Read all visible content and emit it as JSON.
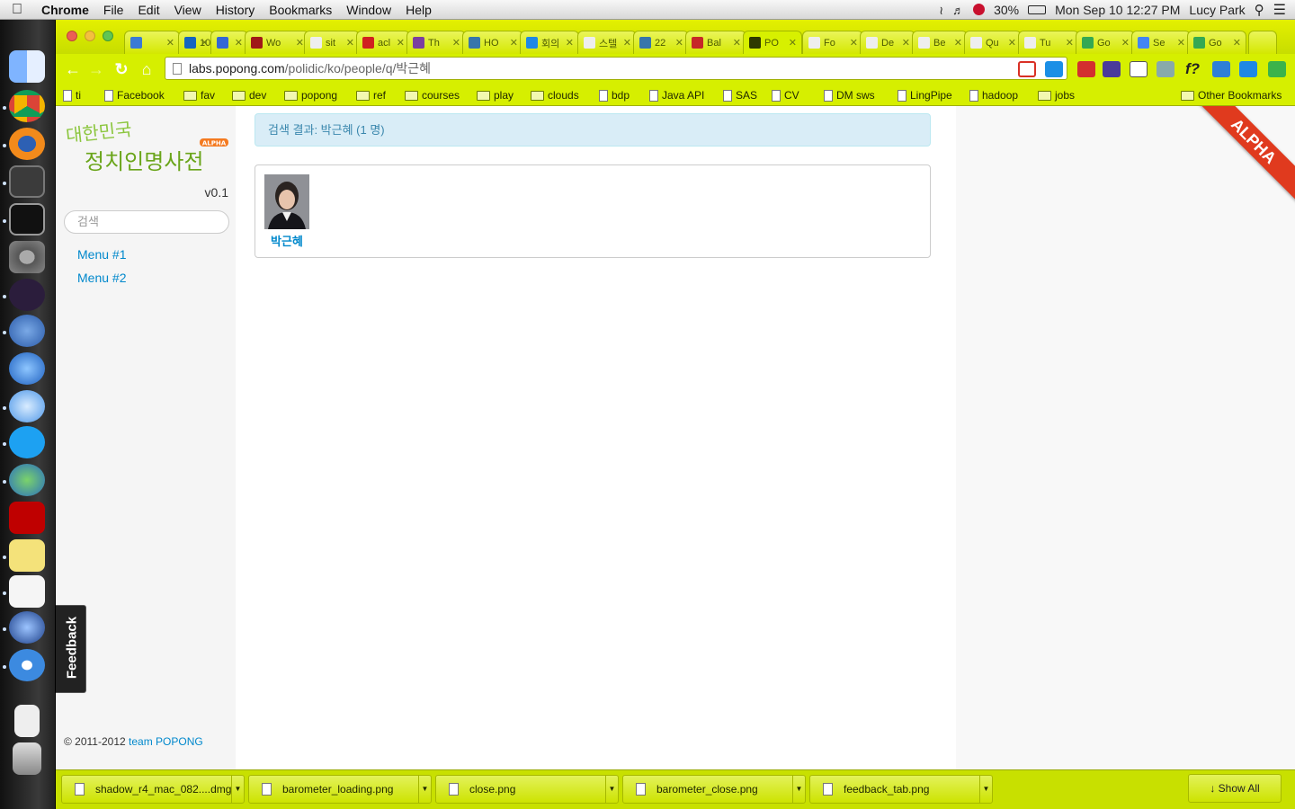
{
  "menubar": {
    "app": "Chrome",
    "items": [
      "File",
      "Edit",
      "View",
      "History",
      "Bookmarks",
      "Window",
      "Help"
    ],
    "battery": "30%",
    "datetime": "Mon Sep 10  12:27 PM",
    "user": "Lucy Park"
  },
  "tabs": [
    {
      "label": "",
      "color": "#3a7bd5"
    },
    {
      "label": "10",
      "color": "#1565c0"
    },
    {
      "label": "",
      "color": "#3367d6"
    },
    {
      "label": "Wo",
      "color": "#a01818"
    },
    {
      "label": "sit",
      "color": "#eeeeee"
    },
    {
      "label": "acl",
      "color": "#d02020"
    },
    {
      "label": "Th",
      "color": "#7b3fa0"
    },
    {
      "label": "HO",
      "color": "#3776ab"
    },
    {
      "label": "회의",
      "color": "#1e88e5"
    },
    {
      "label": "스텔",
      "color": "#eeeeee"
    },
    {
      "label": "22",
      "color": "#3776ab"
    },
    {
      "label": "Bal",
      "color": "#c62828"
    },
    {
      "label": "PO",
      "color": "#2e3a00"
    },
    {
      "label": "Fo",
      "color": "#eeeeee"
    },
    {
      "label": "De",
      "color": "#eeeeee"
    },
    {
      "label": "Be",
      "color": "#eeeeee"
    },
    {
      "label": "Qu",
      "color": "#eeeeee"
    },
    {
      "label": "Tu",
      "color": "#eeeeee"
    },
    {
      "label": "Go",
      "color": "#34a853"
    },
    {
      "label": "Se",
      "color": "#4285f4"
    },
    {
      "label": "Go",
      "color": "#34a853"
    }
  ],
  "address": {
    "domain": "labs.popong.com",
    "path": "/polidic/ko/people/q/박근혜"
  },
  "bookmarks": [
    {
      "label": "ti",
      "type": "page"
    },
    {
      "label": "Facebook",
      "type": "page"
    },
    {
      "label": "fav",
      "type": "folder"
    },
    {
      "label": "dev",
      "type": "folder"
    },
    {
      "label": "popong",
      "type": "folder"
    },
    {
      "label": "ref",
      "type": "folder"
    },
    {
      "label": "courses",
      "type": "folder"
    },
    {
      "label": "play",
      "type": "folder"
    },
    {
      "label": "clouds",
      "type": "folder"
    },
    {
      "label": "bdp",
      "type": "page"
    },
    {
      "label": "Java API",
      "type": "page"
    },
    {
      "label": "SAS",
      "type": "page"
    },
    {
      "label": "CV",
      "type": "page"
    },
    {
      "label": "DM sws",
      "type": "page"
    },
    {
      "label": "LingPipe",
      "type": "page"
    },
    {
      "label": "hadoop",
      "type": "page"
    },
    {
      "label": "jobs",
      "type": "folder"
    }
  ],
  "other_bookmarks": "Other Bookmarks",
  "site": {
    "logo_line1": "대한민국",
    "logo_line2": "정치인명사전",
    "logo_badge": "ALPHA",
    "version": "v0.1",
    "search_placeholder": "검색",
    "menu": [
      "Menu #1",
      "Menu #2"
    ],
    "feedback": "Feedback",
    "copyright_prefix": "© 2011-2012",
    "copyright_link": "team POPONG",
    "ribbon": "ALPHA"
  },
  "results": {
    "header": "검색 결과: 박근혜 (1 명)",
    "people": [
      {
        "name": "박근혜"
      }
    ]
  },
  "downloads": {
    "items": [
      "shadow_r4_mac_082....dmg",
      "barometer_loading.png",
      "close.png",
      "barometer_close.png",
      "feedback_tab.png"
    ],
    "show_all": "Show All"
  },
  "colors": {
    "chrome_theme": "#c8e000",
    "link": "#0088cc",
    "alert_bg": "#d9edf7",
    "alert_text": "#3a87ad",
    "ribbon": "#e03a1e",
    "logo_green": "#7ab51d"
  }
}
